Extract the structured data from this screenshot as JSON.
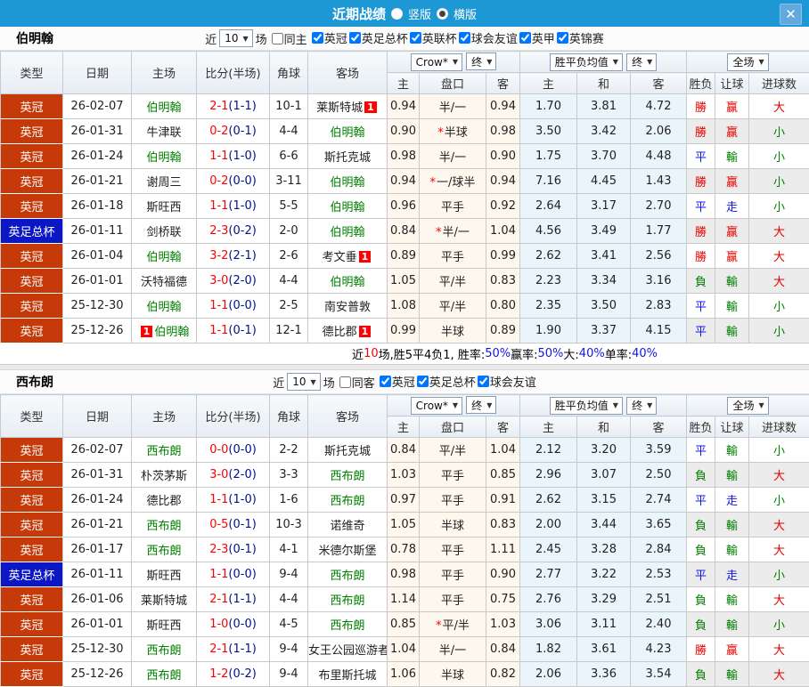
{
  "titlebar": {
    "title": "近期战绩",
    "vertical_label": "竖版",
    "horizontal_label": "横版",
    "close_icon": "x"
  },
  "filter_words": {
    "near": "近",
    "count": "10",
    "matches": "场"
  },
  "columns": {
    "type": "类型",
    "date": "日期",
    "home": "主场",
    "score": "比分(半场)",
    "corner": "角球",
    "away": "客场",
    "odds_select": "Crow*",
    "final_select": "终",
    "odds_sub": [
      "主",
      "盘口",
      "客"
    ],
    "avg_select": "胜平负均值",
    "avg_final_select": "终",
    "avg_sub": [
      "主",
      "和",
      "客"
    ],
    "scope_select": "全场",
    "result_sub": [
      "胜负",
      "让球",
      "进球数"
    ]
  },
  "colors": {
    "win_red": "#e60000",
    "lose_green": "#008000",
    "draw_blue": "#1414e6",
    "league_bg": "#c53a08",
    "cup_bg": "#0b16c5"
  },
  "sections": [
    {
      "team": "伯明翰",
      "same_venue_label": "同主",
      "leagues": [
        "英冠",
        "英足总杯",
        "英联杯",
        "球会友谊",
        "英甲",
        "英锦赛"
      ],
      "summary": [
        [
          "近",
          "k"
        ],
        [
          "10",
          "r"
        ],
        [
          "场,胜5平4负1, 胜率:",
          "k"
        ],
        [
          "50%",
          "b"
        ],
        [
          " 赢率:",
          "k"
        ],
        [
          "50%",
          "b"
        ],
        [
          " 大:",
          "k"
        ],
        [
          "40%",
          "b"
        ],
        [
          " 单率:",
          "k"
        ],
        [
          "40%",
          "b"
        ]
      ],
      "rows": [
        {
          "type": "英冠",
          "cup": false,
          "date": "26-02-07",
          "home": "伯明翰",
          "home_focus": true,
          "home_badge": "",
          "score": "2-1",
          "half": "(1-1)",
          "corner": "10-1",
          "away": "莱斯特城",
          "away_focus": false,
          "away_badge": "1",
          "star": false,
          "odds": [
            "0.94",
            "半/一",
            "0.94"
          ],
          "avg": [
            "1.70",
            "3.81",
            "4.72"
          ],
          "results": [
            [
              "勝",
              "r"
            ],
            [
              "赢",
              "r"
            ],
            [
              "大",
              "r"
            ]
          ]
        },
        {
          "type": "英冠",
          "cup": false,
          "date": "26-01-31",
          "home": "牛津联",
          "home_focus": false,
          "home_badge": "",
          "score": "0-2",
          "half": "(0-1)",
          "corner": "4-4",
          "away": "伯明翰",
          "away_focus": true,
          "away_badge": "",
          "star": true,
          "odds": [
            "0.90",
            "半球",
            "0.98"
          ],
          "avg": [
            "3.50",
            "3.42",
            "2.06"
          ],
          "results": [
            [
              "勝",
              "r"
            ],
            [
              "赢",
              "r"
            ],
            [
              "小",
              "g"
            ]
          ]
        },
        {
          "type": "英冠",
          "cup": false,
          "date": "26-01-24",
          "home": "伯明翰",
          "home_focus": true,
          "home_badge": "",
          "score": "1-1",
          "half": "(1-0)",
          "corner": "6-6",
          "away": "斯托克城",
          "away_focus": false,
          "away_badge": "",
          "star": false,
          "odds": [
            "0.98",
            "半/一",
            "0.90"
          ],
          "avg": [
            "1.75",
            "3.70",
            "4.48"
          ],
          "results": [
            [
              "平",
              "b"
            ],
            [
              "輸",
              "g"
            ],
            [
              "小",
              "g"
            ]
          ]
        },
        {
          "type": "英冠",
          "cup": false,
          "date": "26-01-21",
          "home": "谢周三",
          "home_focus": false,
          "home_badge": "",
          "score": "0-2",
          "half": "(0-0)",
          "corner": "3-11",
          "away": "伯明翰",
          "away_focus": true,
          "away_badge": "",
          "star": true,
          "odds": [
            "0.94",
            "一/球半",
            "0.94"
          ],
          "avg": [
            "7.16",
            "4.45",
            "1.43"
          ],
          "results": [
            [
              "勝",
              "r"
            ],
            [
              "赢",
              "r"
            ],
            [
              "小",
              "g"
            ]
          ]
        },
        {
          "type": "英冠",
          "cup": false,
          "date": "26-01-18",
          "home": "斯旺西",
          "home_focus": false,
          "home_badge": "",
          "score": "1-1",
          "half": "(1-0)",
          "corner": "5-5",
          "away": "伯明翰",
          "away_focus": true,
          "away_badge": "",
          "star": false,
          "odds": [
            "0.96",
            "平手",
            "0.92"
          ],
          "avg": [
            "2.64",
            "3.17",
            "2.70"
          ],
          "results": [
            [
              "平",
              "b"
            ],
            [
              "走",
              "b"
            ],
            [
              "小",
              "g"
            ]
          ]
        },
        {
          "type": "英足总杯",
          "cup": true,
          "date": "26-01-11",
          "home": "剑桥联",
          "home_focus": false,
          "home_badge": "",
          "score": "2-3",
          "half": "(0-2)",
          "corner": "2-0",
          "away": "伯明翰",
          "away_focus": true,
          "away_badge": "",
          "star": true,
          "odds": [
            "0.84",
            "半/一",
            "1.04"
          ],
          "avg": [
            "4.56",
            "3.49",
            "1.77"
          ],
          "results": [
            [
              "勝",
              "r"
            ],
            [
              "赢",
              "r"
            ],
            [
              "大",
              "r"
            ]
          ]
        },
        {
          "type": "英冠",
          "cup": false,
          "date": "26-01-04",
          "home": "伯明翰",
          "home_focus": true,
          "home_badge": "",
          "score": "3-2",
          "half": "(2-1)",
          "corner": "2-6",
          "away": "考文垂",
          "away_focus": false,
          "away_badge": "1",
          "star": false,
          "odds": [
            "0.89",
            "平手",
            "0.99"
          ],
          "avg": [
            "2.62",
            "3.41",
            "2.56"
          ],
          "results": [
            [
              "勝",
              "r"
            ],
            [
              "赢",
              "r"
            ],
            [
              "大",
              "r"
            ]
          ]
        },
        {
          "type": "英冠",
          "cup": false,
          "date": "26-01-01",
          "home": "沃特福德",
          "home_focus": false,
          "home_badge": "",
          "score": "3-0",
          "half": "(2-0)",
          "corner": "4-4",
          "away": "伯明翰",
          "away_focus": true,
          "away_badge": "",
          "star": false,
          "odds": [
            "1.05",
            "平/半",
            "0.83"
          ],
          "avg": [
            "2.23",
            "3.34",
            "3.16"
          ],
          "results": [
            [
              "負",
              "g"
            ],
            [
              "輸",
              "g"
            ],
            [
              "大",
              "r"
            ]
          ]
        },
        {
          "type": "英冠",
          "cup": false,
          "date": "25-12-30",
          "home": "伯明翰",
          "home_focus": true,
          "home_badge": "",
          "score": "1-1",
          "half": "(0-0)",
          "corner": "2-5",
          "away": "南安普敦",
          "away_focus": false,
          "away_badge": "",
          "star": false,
          "odds": [
            "1.08",
            "平/半",
            "0.80"
          ],
          "avg": [
            "2.35",
            "3.50",
            "2.83"
          ],
          "results": [
            [
              "平",
              "b"
            ],
            [
              "輸",
              "g"
            ],
            [
              "小",
              "g"
            ]
          ]
        },
        {
          "type": "英冠",
          "cup": false,
          "date": "25-12-26",
          "home": "伯明翰",
          "home_focus": true,
          "home_badge": "1",
          "score": "1-1",
          "half": "(0-1)",
          "corner": "12-1",
          "away": "德比郡",
          "away_focus": false,
          "away_badge": "1",
          "star": false,
          "odds": [
            "0.99",
            "半球",
            "0.89"
          ],
          "avg": [
            "1.90",
            "3.37",
            "4.15"
          ],
          "results": [
            [
              "平",
              "b"
            ],
            [
              "輸",
              "g"
            ],
            [
              "小",
              "g"
            ]
          ]
        }
      ]
    },
    {
      "team": "西布朗",
      "same_venue_label": "同客",
      "leagues": [
        "英冠",
        "英足总杯",
        "球会友谊"
      ],
      "summary": [],
      "rows": [
        {
          "type": "英冠",
          "cup": false,
          "date": "26-02-07",
          "home": "西布朗",
          "home_focus": true,
          "home_badge": "",
          "score": "0-0",
          "half": "(0-0)",
          "corner": "2-2",
          "away": "斯托克城",
          "away_focus": false,
          "away_badge": "",
          "star": false,
          "odds": [
            "0.84",
            "平/半",
            "1.04"
          ],
          "avg": [
            "2.12",
            "3.20",
            "3.59"
          ],
          "results": [
            [
              "平",
              "b"
            ],
            [
              "輸",
              "g"
            ],
            [
              "小",
              "g"
            ]
          ]
        },
        {
          "type": "英冠",
          "cup": false,
          "date": "26-01-31",
          "home": "朴茨茅斯",
          "home_focus": false,
          "home_badge": "",
          "score": "3-0",
          "half": "(2-0)",
          "corner": "3-3",
          "away": "西布朗",
          "away_focus": true,
          "away_badge": "",
          "star": false,
          "odds": [
            "1.03",
            "平手",
            "0.85"
          ],
          "avg": [
            "2.96",
            "3.07",
            "2.50"
          ],
          "results": [
            [
              "負",
              "g"
            ],
            [
              "輸",
              "g"
            ],
            [
              "大",
              "r"
            ]
          ]
        },
        {
          "type": "英冠",
          "cup": false,
          "date": "26-01-24",
          "home": "德比郡",
          "home_focus": false,
          "home_badge": "",
          "score": "1-1",
          "half": "(1-0)",
          "corner": "1-6",
          "away": "西布朗",
          "away_focus": true,
          "away_badge": "",
          "star": false,
          "odds": [
            "0.97",
            "平手",
            "0.91"
          ],
          "avg": [
            "2.62",
            "3.15",
            "2.74"
          ],
          "results": [
            [
              "平",
              "b"
            ],
            [
              "走",
              "b"
            ],
            [
              "小",
              "g"
            ]
          ]
        },
        {
          "type": "英冠",
          "cup": false,
          "date": "26-01-21",
          "home": "西布朗",
          "home_focus": true,
          "home_badge": "",
          "score": "0-5",
          "half": "(0-1)",
          "corner": "10-3",
          "away": "诺维奇",
          "away_focus": false,
          "away_badge": "",
          "star": false,
          "odds": [
            "1.05",
            "半球",
            "0.83"
          ],
          "avg": [
            "2.00",
            "3.44",
            "3.65"
          ],
          "results": [
            [
              "負",
              "g"
            ],
            [
              "輸",
              "g"
            ],
            [
              "大",
              "r"
            ]
          ]
        },
        {
          "type": "英冠",
          "cup": false,
          "date": "26-01-17",
          "home": "西布朗",
          "home_focus": true,
          "home_badge": "",
          "score": "2-3",
          "half": "(0-1)",
          "corner": "4-1",
          "away": "米德尔斯堡",
          "away_focus": false,
          "away_badge": "",
          "star": false,
          "odds": [
            "0.78",
            "平手",
            "1.11"
          ],
          "avg": [
            "2.45",
            "3.28",
            "2.84"
          ],
          "results": [
            [
              "負",
              "g"
            ],
            [
              "輸",
              "g"
            ],
            [
              "大",
              "r"
            ]
          ]
        },
        {
          "type": "英足总杯",
          "cup": true,
          "date": "26-01-11",
          "home": "斯旺西",
          "home_focus": false,
          "home_badge": "",
          "score": "1-1",
          "half": "(0-0)",
          "corner": "9-4",
          "away": "西布朗",
          "away_focus": true,
          "away_badge": "",
          "star": false,
          "odds": [
            "0.98",
            "平手",
            "0.90"
          ],
          "avg": [
            "2.77",
            "3.22",
            "2.53"
          ],
          "results": [
            [
              "平",
              "b"
            ],
            [
              "走",
              "b"
            ],
            [
              "小",
              "g"
            ]
          ]
        },
        {
          "type": "英冠",
          "cup": false,
          "date": "26-01-06",
          "home": "莱斯特城",
          "home_focus": false,
          "home_badge": "",
          "score": "2-1",
          "half": "(1-1)",
          "corner": "4-4",
          "away": "西布朗",
          "away_focus": true,
          "away_badge": "",
          "star": false,
          "odds": [
            "1.14",
            "平手",
            "0.75"
          ],
          "avg": [
            "2.76",
            "3.29",
            "2.51"
          ],
          "results": [
            [
              "負",
              "g"
            ],
            [
              "輸",
              "g"
            ],
            [
              "大",
              "r"
            ]
          ]
        },
        {
          "type": "英冠",
          "cup": false,
          "date": "26-01-01",
          "home": "斯旺西",
          "home_focus": false,
          "home_badge": "",
          "score": "1-0",
          "half": "(0-0)",
          "corner": "4-5",
          "away": "西布朗",
          "away_focus": true,
          "away_badge": "",
          "star": true,
          "odds": [
            "0.85",
            "平/半",
            "1.03"
          ],
          "avg": [
            "3.06",
            "3.11",
            "2.40"
          ],
          "results": [
            [
              "負",
              "g"
            ],
            [
              "輸",
              "g"
            ],
            [
              "小",
              "g"
            ]
          ]
        },
        {
          "type": "英冠",
          "cup": false,
          "date": "25-12-30",
          "home": "西布朗",
          "home_focus": true,
          "home_badge": "",
          "score": "2-1",
          "half": "(1-1)",
          "corner": "9-4",
          "away": "女王公园巡游者",
          "away_focus": false,
          "away_badge": "",
          "star": false,
          "odds": [
            "1.04",
            "半/一",
            "0.84"
          ],
          "avg": [
            "1.82",
            "3.61",
            "4.23"
          ],
          "results": [
            [
              "勝",
              "r"
            ],
            [
              "赢",
              "r"
            ],
            [
              "大",
              "r"
            ]
          ]
        },
        {
          "type": "英冠",
          "cup": false,
          "date": "25-12-26",
          "home": "西布朗",
          "home_focus": true,
          "home_badge": "",
          "score": "1-2",
          "half": "(0-2)",
          "corner": "9-4",
          "away": "布里斯托城",
          "away_focus": false,
          "away_badge": "",
          "star": false,
          "odds": [
            "1.06",
            "半球",
            "0.82"
          ],
          "avg": [
            "2.06",
            "3.36",
            "3.54"
          ],
          "results": [
            [
              "負",
              "g"
            ],
            [
              "輸",
              "g"
            ],
            [
              "大",
              "r"
            ]
          ]
        }
      ]
    }
  ]
}
